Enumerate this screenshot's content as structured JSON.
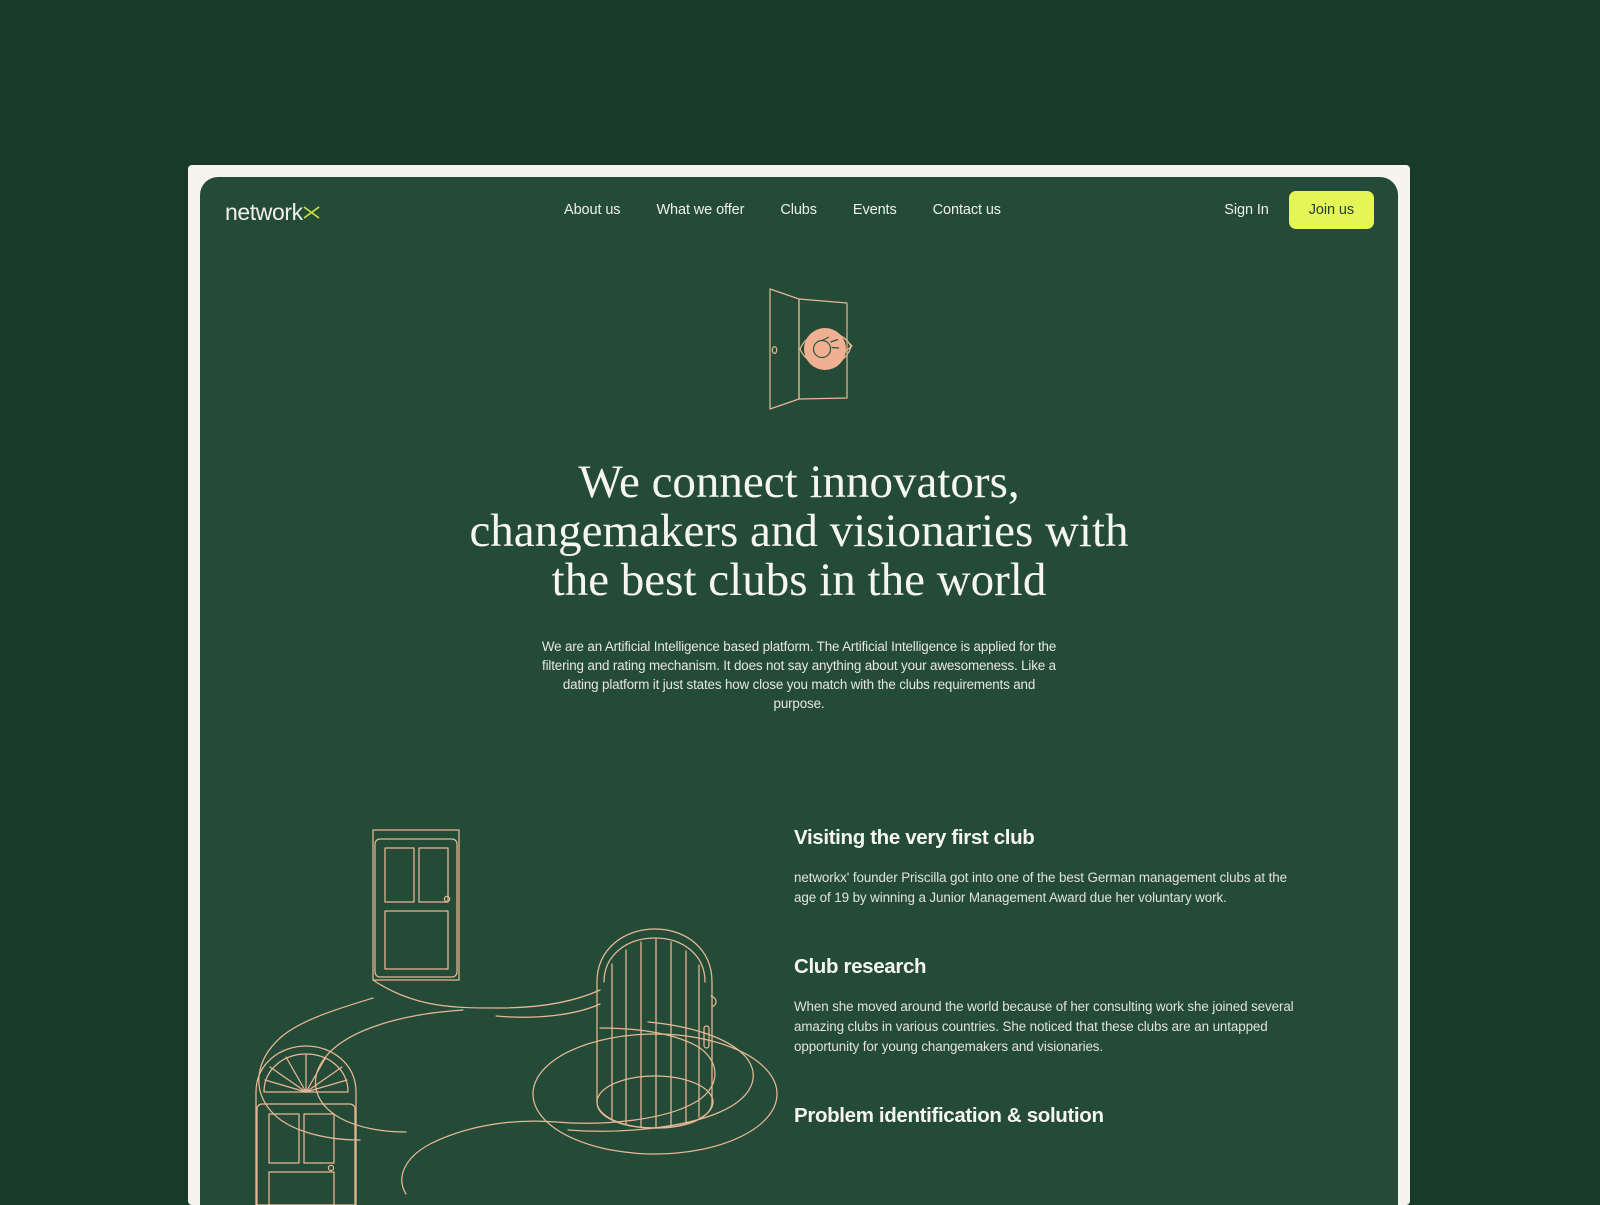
{
  "theme": {
    "page_background": "#183a29",
    "frame_background": "#f7f4ee",
    "panel_background": "#234b37",
    "accent": "#e4f555",
    "illustration_line": "#e8b894",
    "eye_iris": "#f2b092",
    "text_primary": "#f7f5ef",
    "text_secondary": "#e4e2d8"
  },
  "header": {
    "logo": {
      "word": "network",
      "mark": "x",
      "mark_icon": "x-mark-icon"
    },
    "nav": [
      {
        "label": "About us"
      },
      {
        "label": "What we offer"
      },
      {
        "label": "Clubs"
      },
      {
        "label": "Events"
      },
      {
        "label": "Contact us"
      }
    ],
    "sign_in_label": "Sign In",
    "join_us_label": "Join us"
  },
  "hero": {
    "illustration": "open-door-with-eye-illustration",
    "title": "We connect innovators, changemakers and visionaries with the best clubs in the world",
    "subtitle": "We are an Artificial Intelligence based platform. The Artificial Intelligence is applied for the filtering and rating mechanism. It does not say anything about your awesomeness. Like a dating platform it just states how close you match with the clubs requirements and purpose."
  },
  "story": {
    "illustration": "doors-and-winding-paths-illustration",
    "blocks": [
      {
        "heading": "Visiting the very first club",
        "body": "networkx' founder Priscilla got into one of the best German management clubs at the age of 19 by winning a Junior Management Award due her voluntary work."
      },
      {
        "heading": "Club research",
        "body": "When she moved around the world because of her consulting work she joined several amazing clubs in various countries. She noticed that these clubs are an untapped opportunity for young changemakers and visionaries."
      },
      {
        "heading": "Problem identification & solution",
        "body": ""
      }
    ]
  }
}
